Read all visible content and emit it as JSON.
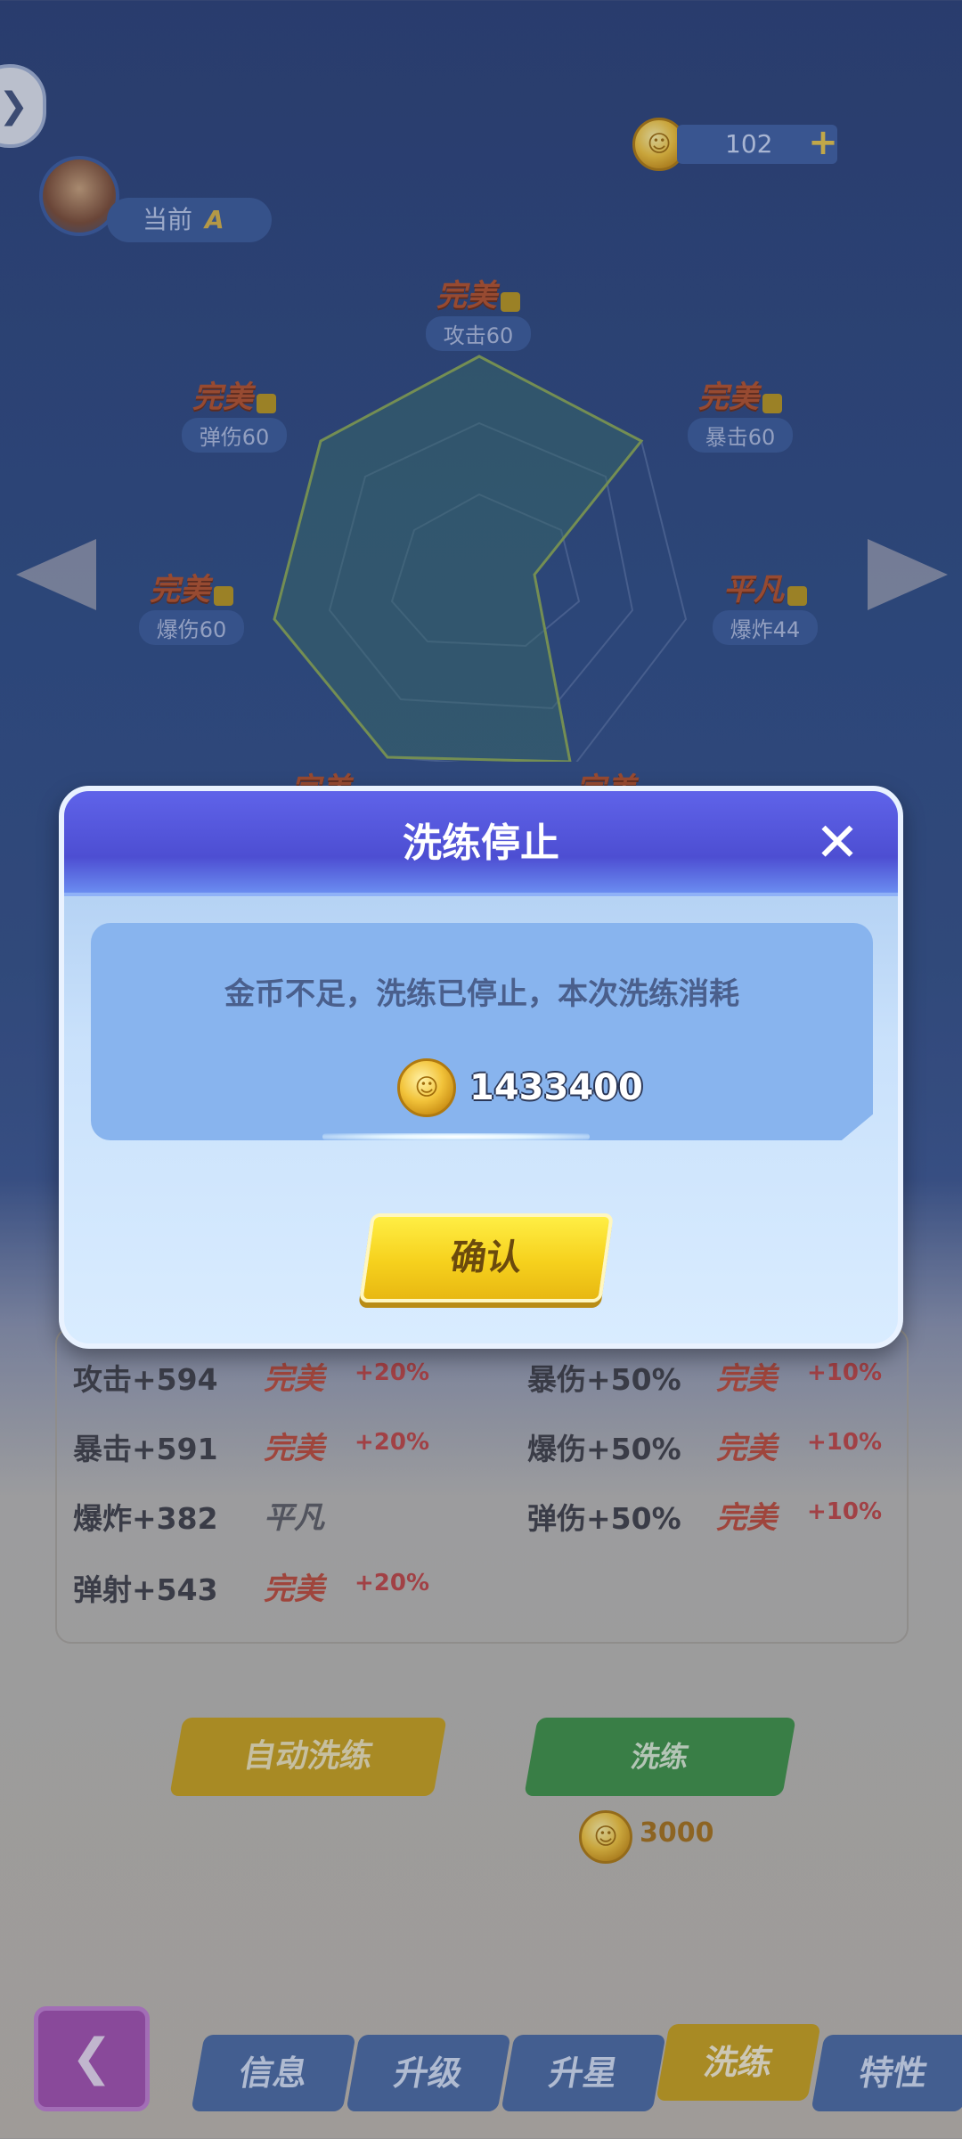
{
  "topbar": {
    "coin_count": "102",
    "plus": "+",
    "rank_label": "当前",
    "rank_value": "A"
  },
  "radar": {
    "top": {
      "grade": "完美",
      "value": "攻击60"
    },
    "upper_left": {
      "grade": "完美",
      "value": "弹伤60"
    },
    "upper_right": {
      "grade": "完美",
      "value": "暴击60"
    },
    "mid_left": {
      "grade": "完美",
      "value": "爆伤60"
    },
    "mid_right": {
      "grade": "平凡",
      "value": "爆炸44"
    },
    "bottom_left": {
      "grade": "完美"
    },
    "bottom_right": {
      "grade": "完美"
    }
  },
  "stats": {
    "left": [
      {
        "name": "攻击+594",
        "grade": "完美",
        "bonus": "+20%"
      },
      {
        "name": "暴击+591",
        "grade": "完美",
        "bonus": "+20%"
      },
      {
        "name": "爆炸+382",
        "grade": "平凡",
        "bonus": ""
      },
      {
        "name": "弹射+543",
        "grade": "完美",
        "bonus": "+20%"
      }
    ],
    "right": [
      {
        "name": "暴伤+50%",
        "grade": "完美",
        "bonus": "+10%"
      },
      {
        "name": "爆伤+50%",
        "grade": "完美",
        "bonus": "+10%"
      },
      {
        "name": "弹伤+50%",
        "grade": "完美",
        "bonus": "+10%"
      }
    ]
  },
  "actions": {
    "auto_wash": "自动洗练",
    "wash": "洗练",
    "wash_cost": "3000"
  },
  "tabs": [
    "信息",
    "升级",
    "升星",
    "洗练",
    "特性"
  ],
  "active_tab": "洗练",
  "dialog": {
    "title": "洗练停止",
    "message": "金币不足，洗练已停止，本次洗练消耗",
    "amount": "1433400",
    "confirm": "确认"
  },
  "colors": {
    "dialog_header": "#4d4ed2",
    "confirm_button": "#f6d11d",
    "active_tab": "#c9a11c",
    "wash_button": "#3e9246"
  }
}
